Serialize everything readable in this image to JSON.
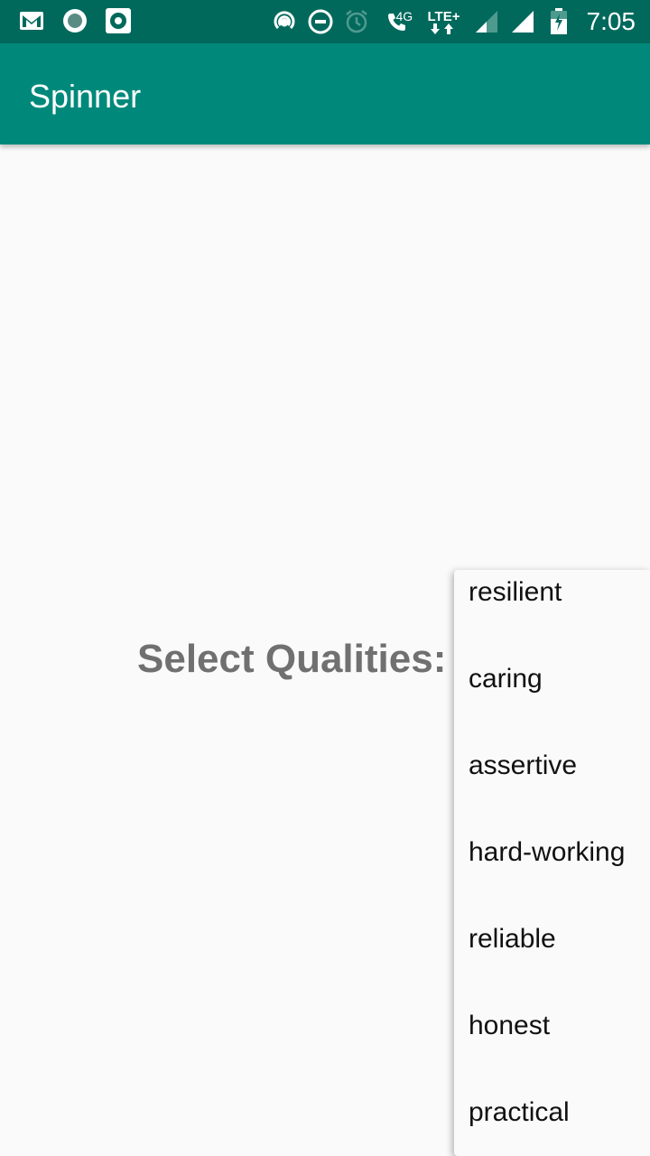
{
  "status_bar": {
    "left_icons": [
      "gmail-icon",
      "record-icon",
      "camera-icon"
    ],
    "right_icons": [
      "hotspot-icon",
      "do-not-disturb-icon",
      "alarm-icon",
      "volte-call-icon",
      "lte-data-icon",
      "signal-icon",
      "signal-full-icon",
      "battery-charging-icon"
    ],
    "net_4g": "4G",
    "net_lte": "LTE+",
    "time": "7:05"
  },
  "app_bar": {
    "title": "Spinner"
  },
  "main": {
    "prompt": "Select Qualities:"
  },
  "dropdown": {
    "options": [
      "resilient",
      "caring",
      "assertive",
      "hard-working",
      "reliable",
      "honest",
      "practical"
    ]
  },
  "colors": {
    "status_bar": "#00695c",
    "app_bar": "#00897b",
    "background": "#fafafa",
    "prompt_text": "#707070"
  }
}
